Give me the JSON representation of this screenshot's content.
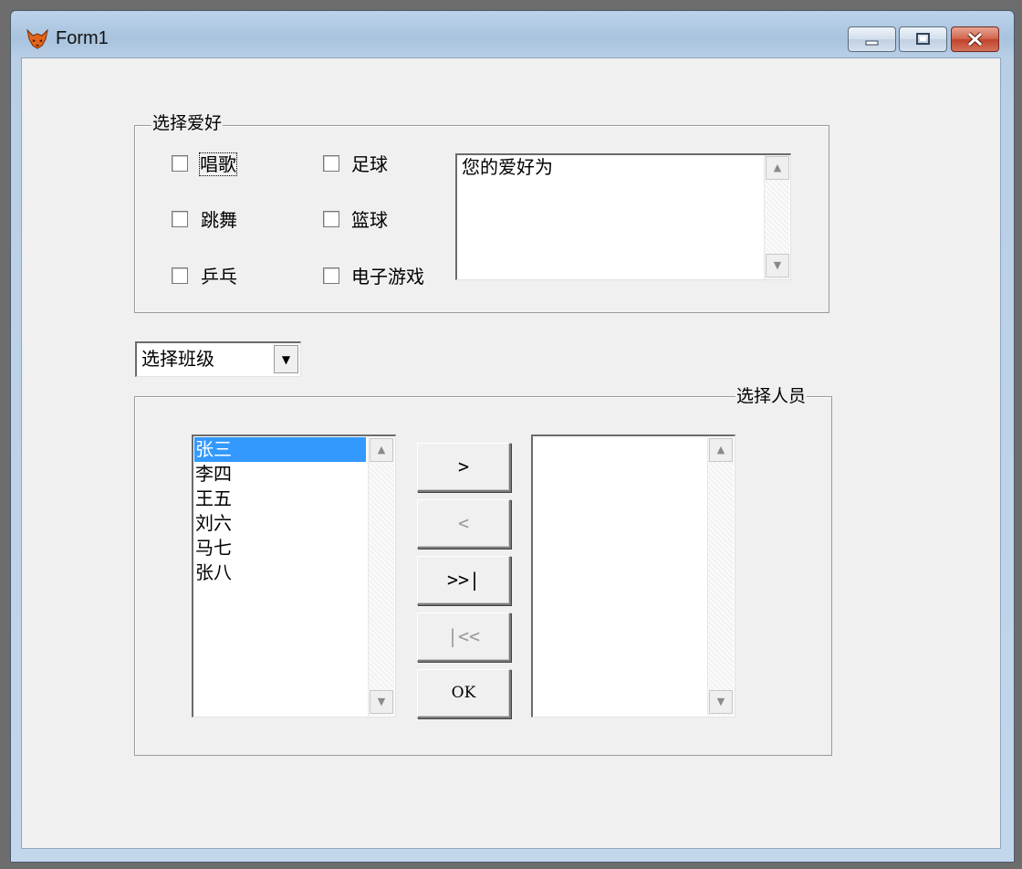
{
  "window": {
    "title": "Form1",
    "icon": "fox-icon",
    "controls": {
      "minimize": "minimize-icon",
      "maximize": "maximize-icon",
      "close": "close-icon"
    }
  },
  "hobby_group": {
    "label": "选择爱好",
    "checkboxes": [
      {
        "label": "唱歌",
        "checked": false
      },
      {
        "label": "足球",
        "checked": false
      },
      {
        "label": "跳舞",
        "checked": false
      },
      {
        "label": "篮球",
        "checked": false
      },
      {
        "label": "乒乓",
        "checked": false
      },
      {
        "label": "电子游戏",
        "checked": false
      }
    ],
    "result_text": "您的爱好为"
  },
  "class_combo": {
    "value": "选择班级"
  },
  "people_group": {
    "label": "选择人员",
    "source_list": [
      "张三",
      "李四",
      "王五",
      "刘六",
      "马七",
      "张八"
    ],
    "selected_index": 0,
    "target_list": [],
    "buttons": {
      "move_right": ">",
      "move_left": "<",
      "move_all_right": ">>|",
      "move_all_left": "|<<",
      "ok": "OK"
    }
  },
  "colors": {
    "selection": "#3399ff",
    "client_bg": "#f0f0f0"
  }
}
